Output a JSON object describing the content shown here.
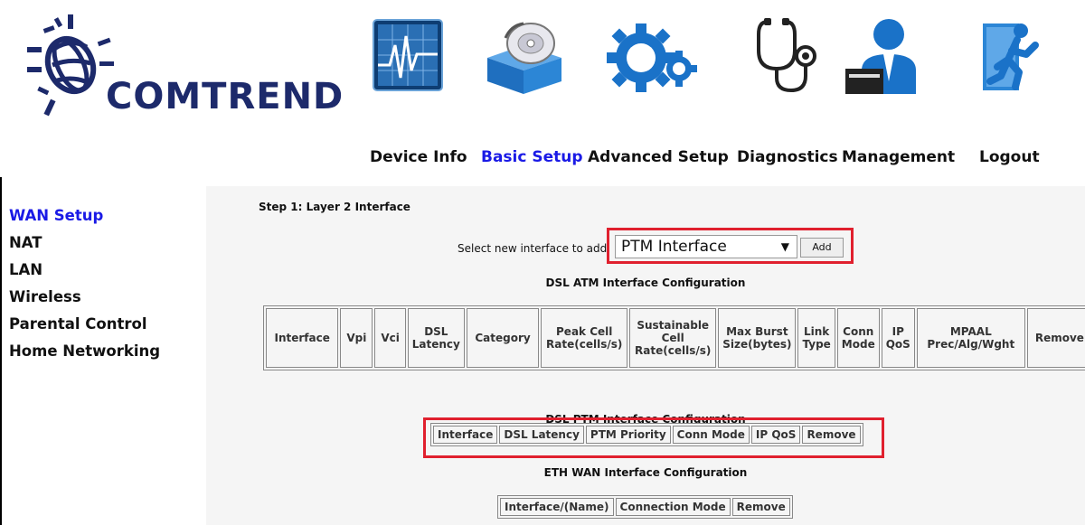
{
  "brand": {
    "name": "COMTREND"
  },
  "nav": [
    {
      "label": "Device Info",
      "icon": "device-info-icon",
      "active": false
    },
    {
      "label": "Basic Setup",
      "icon": "basic-setup-icon",
      "active": true
    },
    {
      "label": "Advanced Setup",
      "icon": "advanced-setup-icon",
      "active": false
    },
    {
      "label": "Diagnostics",
      "icon": "diagnostics-icon",
      "active": false
    },
    {
      "label": "Management",
      "icon": "management-icon",
      "active": false
    },
    {
      "label": "Logout",
      "icon": "logout-icon",
      "active": false
    }
  ],
  "sidebar": {
    "items": [
      {
        "label": "WAN Setup",
        "active": true
      },
      {
        "label": "NAT",
        "active": false
      },
      {
        "label": "LAN",
        "active": false
      },
      {
        "label": "Wireless",
        "active": false
      },
      {
        "label": "Parental Control",
        "active": false
      },
      {
        "label": "Home Networking",
        "active": false
      }
    ]
  },
  "main": {
    "step_title": "Step 1: Layer 2 Interface",
    "select_label": "Select new interface to add:",
    "select_value": "PTM Interface",
    "add_label": "Add",
    "atm": {
      "title": "DSL ATM Interface Configuration",
      "headers": [
        "Interface",
        "Vpi",
        "Vci",
        "DSL Latency",
        "Category",
        "Peak Cell Rate(cells/s)",
        "Sustainable Cell Rate(cells/s)",
        "Max Burst Size(bytes)",
        "Link Type",
        "Conn Mode",
        "IP QoS",
        "MPAAL Prec/Alg/Wght",
        "Remove"
      ]
    },
    "ptm": {
      "title": "DSL PTM Interface Configuration",
      "headers": [
        "Interface",
        "DSL Latency",
        "PTM Priority",
        "Conn Mode",
        "IP QoS",
        "Remove"
      ]
    },
    "eth": {
      "title": "ETH WAN Interface Configuration",
      "headers": [
        "Interface/(Name)",
        "Connection Mode",
        "Remove"
      ]
    }
  },
  "colors": {
    "accent": "#1a1ae6",
    "highlight": "#e0202e",
    "content_bg": "#f5f5f5"
  }
}
